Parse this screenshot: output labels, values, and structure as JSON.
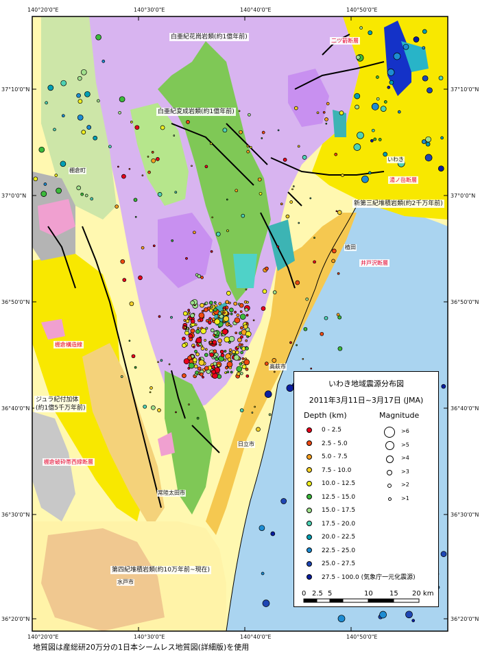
{
  "axis": {
    "lon_ticks_top": [
      "140°20'0\"E",
      "140°30'0\"E",
      "140°40'0\"E",
      "140°50'0\"E"
    ],
    "lon_ticks_bottom": [
      "140°20'0\"E",
      "140°30'0\"E",
      "140°40'0\"E",
      "140°50'0\"E"
    ],
    "lat_ticks": [
      "37°10'0\"N",
      "37°0'0\"N",
      "36°50'0\"N",
      "36°40'0\"N",
      "36°30'0\"N",
      "36°20'0\"N"
    ]
  },
  "geology_labels": {
    "cretaceous_granite": "白亜紀花崗岩類(約1億年前)",
    "cretaceous_metamorphic": "白亜紀変成岩類(約1億年前)",
    "neogene_sediment": "新第三紀堆積岩類(約2千万年前)",
    "jurassic_accretion_1": "ジュラ紀付加体",
    "jurassic_accretion_2": "(約1億5千万年前)",
    "quaternary_sediment": "第四紀堆積岩類(約10万年前~現在)"
  },
  "fault_labels": {
    "futatsuya": "二ツ箭断層",
    "yunotake": "湯ノ岳断層",
    "idosawa": "井戸沢断層",
    "tanakura": "棚倉構造線",
    "tanakura_west": "棚倉破砕帯西縁断層"
  },
  "city_labels": {
    "tanagura": "棚倉町",
    "iwaki": "いわき",
    "ueda": "植田",
    "takahagi": "高萩市",
    "hitachi": "日立市",
    "hitachiota": "常陸太田市",
    "mito": "水戸市"
  },
  "legend": {
    "title": "いわき地域震源分布図",
    "date": "2011年3月11日~3月17日 (JMA)",
    "depth_header": "Depth (km)",
    "magnitude_header": "Magnitude",
    "depth_ranges": [
      {
        "label": "0 - 2.5",
        "color": "#e8001c"
      },
      {
        "label": "2.5 - 5.0",
        "color": "#f04a12"
      },
      {
        "label": "5.0 - 7.5",
        "color": "#f7a020"
      },
      {
        "label": "7.5 - 10.0",
        "color": "#f5d228"
      },
      {
        "label": "10.0 - 12.5",
        "color": "#f0f020"
      },
      {
        "label": "12.5 - 15.0",
        "color": "#3cba3c"
      },
      {
        "label": "15.0 - 17.5",
        "color": "#a0e08c"
      },
      {
        "label": "17.5 - 20.0",
        "color": "#4fd2b4"
      },
      {
        "label": "20.0 - 22.5",
        "color": "#00a0b4"
      },
      {
        "label": "22.5 - 25.0",
        "color": "#1e8cd2"
      },
      {
        "label": "25.0 - 27.5",
        "color": "#1e46b4"
      },
      {
        "label": "27.5 - 100.0 (気象庁一元化震源)",
        "color": "#0a1ea0"
      }
    ],
    "magnitudes": [
      ">6",
      ">5",
      ">4",
      ">3",
      ">2",
      ">1"
    ],
    "scale_labels": [
      "0",
      "2.5",
      "5",
      "10",
      "15",
      "20 km"
    ]
  },
  "caption": "地質図は産総研20万分の1日本シームレス地質図(詳細版)を使用",
  "colors": {
    "sea": "#aad4f0",
    "granite": "#d8b4f0",
    "metamorphic": "#7fc856",
    "neogene": "#f8e800",
    "quaternary": "#fff8b0",
    "accretion": "#b4b4b4"
  }
}
